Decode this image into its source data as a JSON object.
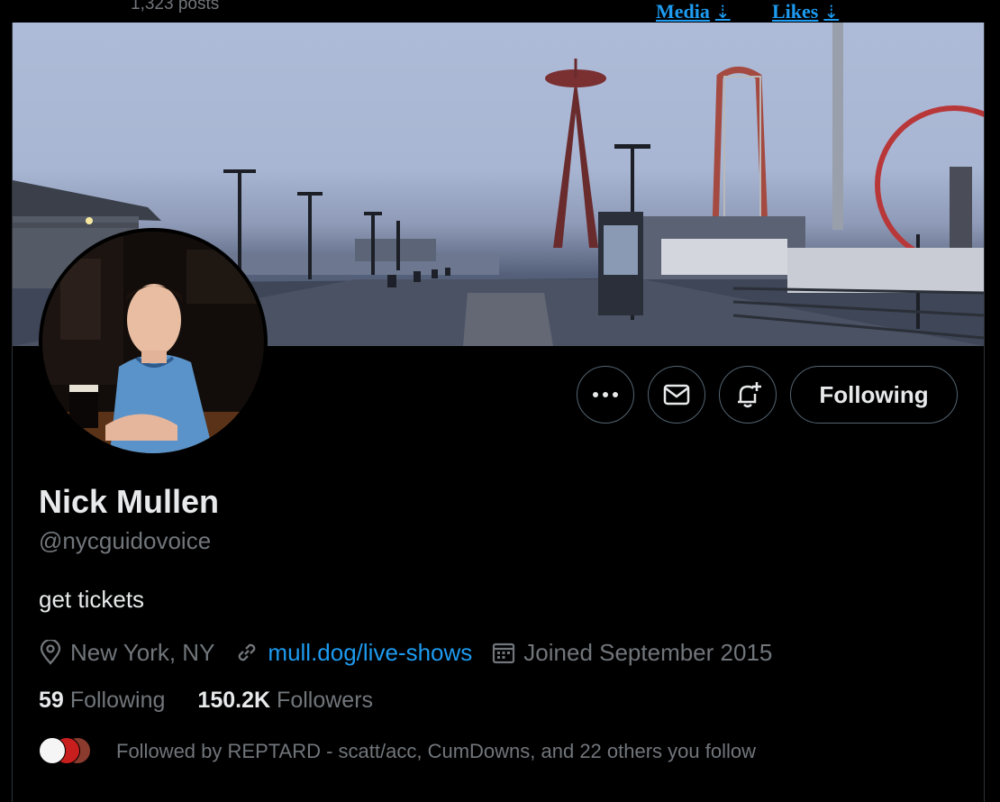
{
  "topbar": {
    "posts_count": "1,323 posts",
    "tabs": [
      {
        "label": "Media",
        "arrow": "⇣"
      },
      {
        "label": "Likes",
        "arrow": "⇣"
      }
    ]
  },
  "profile": {
    "display_name": "Nick Mullen",
    "handle": "@nycguidovoice",
    "bio": "get tickets",
    "location": "New York, NY",
    "website": "mull.dog/live-shows",
    "joined": "Joined September 2015",
    "following_count": "59",
    "following_label": "Following",
    "followers_count": "150.2K",
    "followers_label": "Followers",
    "followed_by": "Followed by REPTARD - scatt/acc, CumDowns, and 22 others you follow"
  },
  "actions": {
    "more_icon": "more-dots-icon",
    "message_icon": "envelope-icon",
    "notify_icon": "bell-plus-icon",
    "follow_button_label": "Following"
  },
  "colors": {
    "background": "#000000",
    "accent": "#1d9bf0",
    "text_primary": "#e7e9ea",
    "text_secondary": "#71767b",
    "border": "#536471"
  }
}
